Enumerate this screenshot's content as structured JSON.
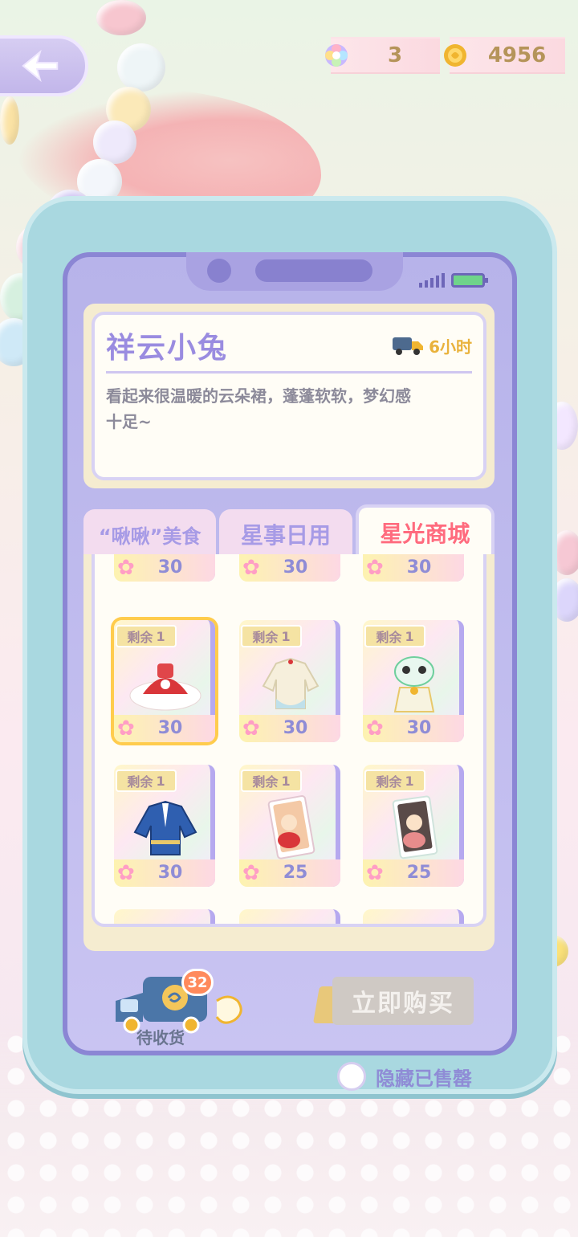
{
  "currency": {
    "star_count": "3",
    "coin_count": "4956"
  },
  "item": {
    "name": "祥云小兔",
    "ship_time": "6小时",
    "desc_line1": "看起来很温暖的云朵裙，蓬蓬软软，梦幻感",
    "desc_line2": "十足~"
  },
  "tabs": [
    {
      "label": "“啾啾”美食"
    },
    {
      "label": "星事日用"
    },
    {
      "label": "星光商城"
    }
  ],
  "grid": {
    "remain_label": "剩余",
    "top_row_prices": [
      "30",
      "30",
      "30"
    ],
    "row1": [
      {
        "remain": "1",
        "price": "30",
        "icon": "red-dress-icon"
      },
      {
        "remain": "1",
        "price": "30",
        "icon": "white-coat-icon"
      },
      {
        "remain": "1",
        "price": "30",
        "icon": "lion-dance-outfit-icon"
      }
    ],
    "row2": [
      {
        "remain": "1",
        "price": "30",
        "icon": "blue-jacket-icon"
      },
      {
        "remain": "1",
        "price": "25",
        "icon": "photo-card-icon"
      },
      {
        "remain": "1",
        "price": "25",
        "icon": "photo-card-icon"
      }
    ]
  },
  "delivery": {
    "label": "待收货",
    "badge": "32"
  },
  "buy_button": "立即购买",
  "hide_sold_label": "隐藏已售罄",
  "colors": {
    "accent_tab": "#ff6b7e",
    "purple": "#8f8cd6",
    "ship_yellow": "#e9b23c"
  }
}
